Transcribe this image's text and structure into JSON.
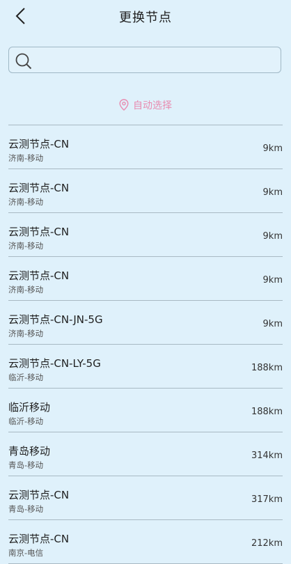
{
  "header": {
    "title": "更换节点",
    "back_icon": "chevron-left-icon"
  },
  "search": {
    "value": "",
    "placeholder": "",
    "icon": "search-icon"
  },
  "auto_select": {
    "label": "自动选择",
    "icon": "location-pin-icon",
    "color": "#e88bb0"
  },
  "nodes": [
    {
      "name": "云测节点-CN",
      "location": "济南-移动",
      "distance": "9km"
    },
    {
      "name": "云测节点-CN",
      "location": "济南-移动",
      "distance": "9km"
    },
    {
      "name": "云测节点-CN",
      "location": "济南-移动",
      "distance": "9km"
    },
    {
      "name": "云测节点-CN",
      "location": "济南-移动",
      "distance": "9km"
    },
    {
      "name": "云测节点-CN-JN-5G",
      "location": "济南-移动",
      "distance": "9km"
    },
    {
      "name": "云测节点-CN-LY-5G",
      "location": "临沂-移动",
      "distance": "188km"
    },
    {
      "name": "临沂移动",
      "location": "临沂-移动",
      "distance": "188km"
    },
    {
      "name": "青岛移动",
      "location": "青岛-移动",
      "distance": "314km"
    },
    {
      "name": "云测节点-CN",
      "location": "青岛-移动",
      "distance": "317km"
    },
    {
      "name": "云测节点-CN",
      "location": "南京-电信",
      "distance": "212km"
    }
  ]
}
